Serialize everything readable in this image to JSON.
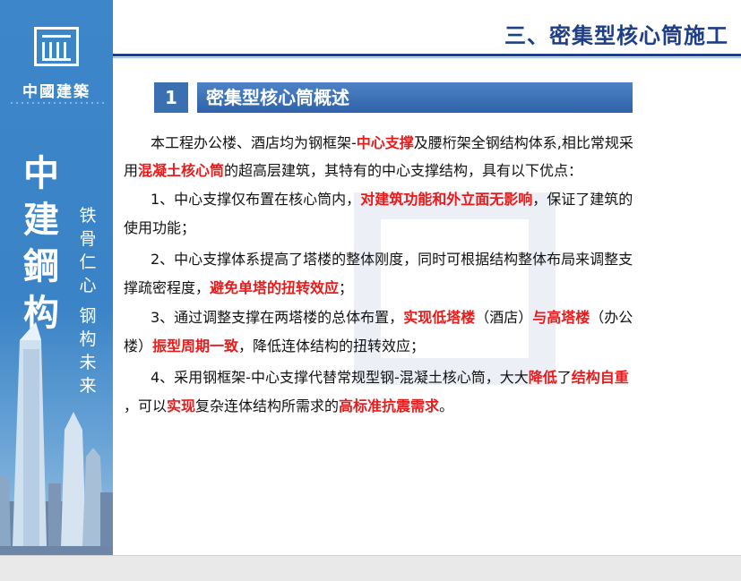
{
  "slide": {
    "title": "三、密集型核心筒施工",
    "section_number": "1",
    "section_title": "密集型核心筒概述"
  },
  "sidebar": {
    "brand": "中國建築",
    "big_text": [
      "中",
      "建",
      "鋼",
      "构"
    ],
    "motto_lines": [
      "铁",
      "骨",
      "仁",
      "心",
      "钢",
      "构",
      "未",
      "来"
    ]
  },
  "body": {
    "intro_a": "本工程办公楼、酒店均为钢框架-",
    "intro_hl1": "中心支撑",
    "intro_b": "及腰桁架全钢结构体系,相比常规采",
    "intro_c": "用",
    "intro_hl2": "混凝土核心筒",
    "intro_d": "的超高层建筑，其特有的中心支撑结构，具有以下优点：",
    "p1_a": "1、中心支撑仅布置在核心筒内，",
    "p1_hl": "对建筑功能和外立面无影响",
    "p1_b": "，保证了建筑的",
    "p1_c": "使用功能；",
    "p2_a": "2、中心支撑体系提高了塔楼的整体刚度，同时可根据结构整体布局来调整支",
    "p2_b": "撑疏密程度，",
    "p2_hl": "避免单塔的扭转效应",
    "p2_c": "；",
    "p3_a": "3、通过调整支撑在两塔楼的总体布置，",
    "p3_hl1": "实现低塔楼",
    "p3_b": "（酒店）",
    "p3_hl2": "与高塔楼",
    "p3_c": "（办公",
    "p3_d": "楼）",
    "p3_hl3": "振型周期一致",
    "p3_e": "，降低连体结构的扭转效应；",
    "p4_a": "4、采用钢框架-中心支撑代替常规型钢-混凝土核心筒，大大",
    "p4_hl1": "降低",
    "p4_b": "了",
    "p4_hl2": "结构自重",
    "p4_c": "，可以",
    "p4_hl3": "实现",
    "p4_d": "复杂连体结构所需求的",
    "p4_hl4": "高标准抗震需求",
    "p4_e": "。"
  },
  "colors": {
    "title_blue": "#1e3f87",
    "highlight_red": "#e81a1a",
    "sidebar_blue": "#3a83c6"
  }
}
